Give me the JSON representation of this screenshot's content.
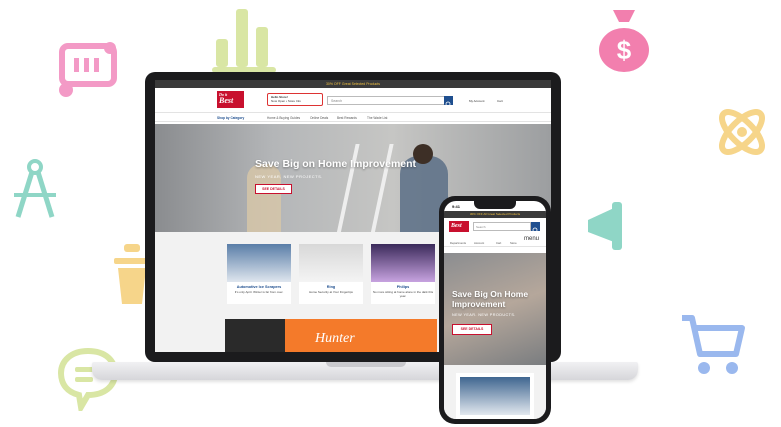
{
  "colors": {
    "brand_red": "#c8102e",
    "nav_blue": "#1f4f8f",
    "promo_bar": "#3a3a3a",
    "promo_text": "#f0c040",
    "banner_orange": "#f47a2a"
  },
  "decorations": {
    "icons": [
      "tag-icon",
      "bar-chart-icon",
      "money-bag-icon",
      "atom-icon",
      "compass-icon",
      "megaphone-icon",
      "basket-icon",
      "chat-icon",
      "cart-icon"
    ]
  },
  "laptop": {
    "promo": "30% OFF Great Selected Products",
    "logo_top": "Do it",
    "logo_bottom": "Best",
    "store_name": "Hello Store!",
    "store_hours": "Now Open • Store Info",
    "search_placeholder": "Search",
    "account": "My Account",
    "cart": "Cart",
    "nav": [
      "Shop by Category",
      "Home & Buying Guides",
      "Online Deals",
      "Best Rewards",
      "The Wade List"
    ],
    "hero": {
      "title": "Save Big on Home Improvement",
      "subtitle": "NEW YEAR, NEW PROJECTS.",
      "button": "SEE DETAILS"
    },
    "products": [
      {
        "title": "Automotive Ice Scrapers",
        "desc": "It's only April. Winter is far from over."
      },
      {
        "title": "Ring",
        "desc": "Home Security at Your Fingertips"
      },
      {
        "title": "Philips",
        "desc": "No more sitting at home alone in the dark this year."
      }
    ],
    "banner_brand": "Hunter"
  },
  "phone": {
    "time": "9:41",
    "promo": "30% OFF All Great Selected Products",
    "logo": "Best",
    "search_placeholder": "Search",
    "icons": [
      "Departments",
      "Account",
      "Cart",
      "Store"
    ],
    "menu": "menu",
    "hero": {
      "title": "Save Big On Home Improvement",
      "subtitle": "NEW YEAR. NEW PRODUCTS.",
      "button": "SEE DETAILS"
    }
  }
}
